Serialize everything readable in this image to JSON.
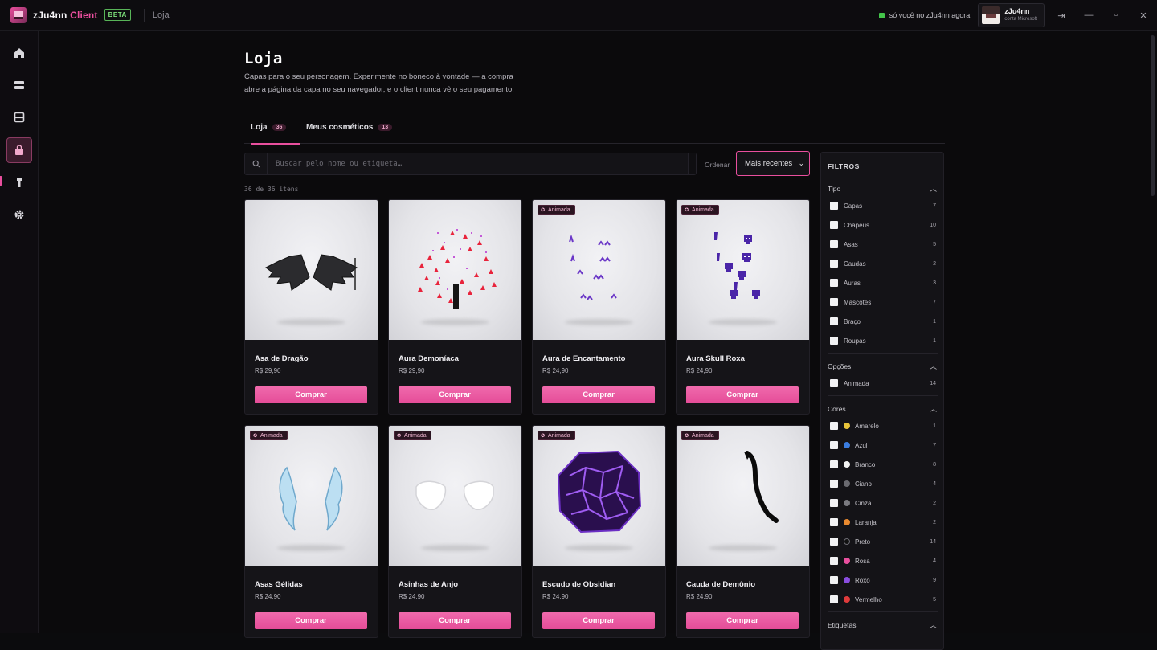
{
  "app": {
    "name": "zJu4nn",
    "client_word": "Client",
    "beta": "BETA",
    "breadcrumb": "Loja",
    "status": "só você no zJu4nn agora",
    "account_name": "zJu4nn",
    "account_sub": "conta Microsoft"
  },
  "window": {
    "logout": "⇥",
    "minimize": "—",
    "maximize": "▫",
    "close": "✕"
  },
  "sidebar": {
    "items": [
      {
        "name": "home",
        "icon": "home-icon"
      },
      {
        "name": "servers",
        "icon": "server-icon"
      },
      {
        "name": "instances",
        "icon": "box-icon"
      },
      {
        "name": "store",
        "icon": "shopping-bag-icon",
        "active": true
      },
      {
        "name": "cosmetics",
        "icon": "shirt-icon"
      },
      {
        "name": "settings",
        "icon": "gear-icon"
      }
    ]
  },
  "page": {
    "title": "Loja",
    "description": "Capas para o seu personagem. Experimente no boneco à vontade — a compra abre a página da capa no seu navegador, e o client nunca vê o seu pagamento.",
    "tabs": [
      {
        "label": "Loja",
        "count": "36"
      },
      {
        "label": "Meus cosméticos",
        "count": "13"
      }
    ],
    "search_placeholder": "Buscar pelo nome ou etiqueta…",
    "sort_label": "Ordenar",
    "sort_value": "Mais recentes",
    "item_count": "36 de 36 itens"
  },
  "products": [
    {
      "name": "Asa de Dragão",
      "price": "R$ 29,90",
      "animated": false,
      "buy": "Comprar"
    },
    {
      "name": "Aura Demoníaca",
      "price": "R$ 29,90",
      "animated": false,
      "buy": "Comprar"
    },
    {
      "name": "Aura de Encantamento",
      "price": "R$ 24,90",
      "animated": true,
      "buy": "Comprar"
    },
    {
      "name": "Aura Skull Roxa",
      "price": "R$ 24,90",
      "animated": true,
      "buy": "Comprar"
    },
    {
      "name": "Asas Gélidas",
      "price": "R$ 24,90",
      "animated": true,
      "buy": "Comprar"
    },
    {
      "name": "Asinhas de Anjo",
      "price": "R$ 24,90",
      "animated": true,
      "buy": "Comprar"
    },
    {
      "name": "Escudo de Obsidian",
      "price": "R$ 24,90",
      "animated": true,
      "buy": "Comprar"
    },
    {
      "name": "Cauda de Demônio",
      "price": "R$ 24,90",
      "animated": true,
      "buy": "Comprar"
    }
  ],
  "animated_label": "Animada",
  "filters": {
    "title": "FILTROS",
    "tipo": {
      "label": "Tipo",
      "items": [
        {
          "label": "Capas",
          "count": "7"
        },
        {
          "label": "Chapéus",
          "count": "10"
        },
        {
          "label": "Asas",
          "count": "5"
        },
        {
          "label": "Caudas",
          "count": "2"
        },
        {
          "label": "Auras",
          "count": "3"
        },
        {
          "label": "Mascotes",
          "count": "7"
        },
        {
          "label": "Braço",
          "count": "1"
        },
        {
          "label": "Roupas",
          "count": "1"
        }
      ]
    },
    "opcoes": {
      "label": "Opções",
      "items": [
        {
          "label": "Animada",
          "count": "14"
        }
      ]
    },
    "cores": {
      "label": "Cores",
      "items": [
        {
          "label": "Amarelo",
          "count": "1",
          "color": "#e8c43a"
        },
        {
          "label": "Azul",
          "count": "7",
          "color": "#3b7de0"
        },
        {
          "label": "Branco",
          "count": "8",
          "color": "#f2f2f2"
        },
        {
          "label": "Ciano",
          "count": "4",
          "color": "#6a6a70"
        },
        {
          "label": "Cinza",
          "count": "2",
          "color": "#7a7a80"
        },
        {
          "label": "Laranja",
          "count": "2",
          "color": "#e8892f"
        },
        {
          "label": "Preto",
          "count": "14",
          "color": "#111111"
        },
        {
          "label": "Rosa",
          "count": "4",
          "color": "#e94f9e"
        },
        {
          "label": "Roxo",
          "count": "9",
          "color": "#8a4de0"
        },
        {
          "label": "Vermelho",
          "count": "5",
          "color": "#e03b3b"
        }
      ]
    },
    "etiquetas": {
      "label": "Etiquetas"
    }
  }
}
